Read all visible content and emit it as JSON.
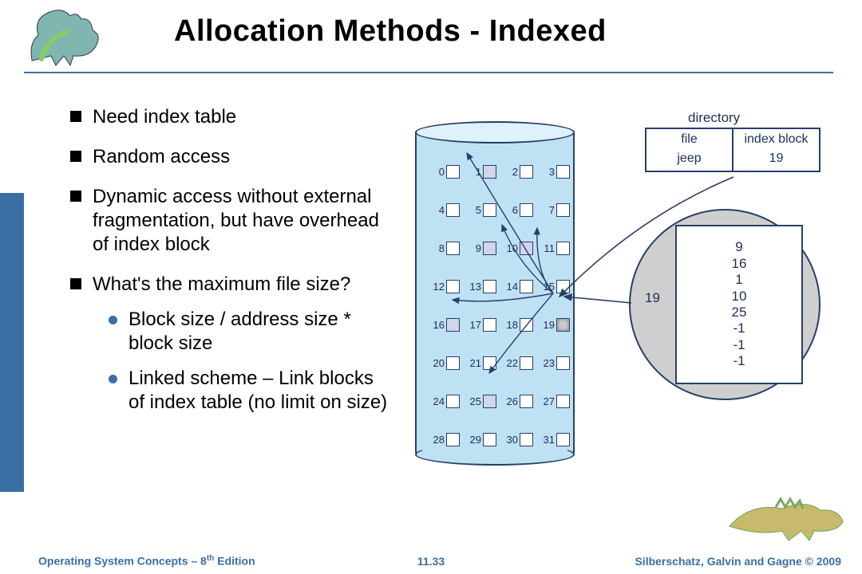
{
  "title": "Allocation Methods - Indexed",
  "bullets": {
    "items": [
      {
        "text": "Need index table"
      },
      {
        "text": "Random access"
      },
      {
        "text": "Dynamic access without external fragmentation, but have overhead of index block"
      },
      {
        "text": "What's the maximum file size?"
      }
    ],
    "sub": [
      {
        "text": "Block size / address size * block size"
      },
      {
        "text": "Linked scheme – Link blocks of index table (no limit on size)"
      }
    ]
  },
  "figure": {
    "directory_label": "directory",
    "dir_headers": {
      "col1": "file",
      "col2": "index block"
    },
    "dir_values": {
      "col1": "jeep",
      "col2": "19"
    },
    "cells": [
      "0",
      "1",
      "2",
      "3",
      "4",
      "5",
      "6",
      "7",
      "8",
      "9",
      "10",
      "11",
      "12",
      "13",
      "14",
      "15",
      "16",
      "17",
      "18",
      "19",
      "20",
      "21",
      "22",
      "23",
      "24",
      "25",
      "26",
      "27",
      "28",
      "29",
      "30",
      "31"
    ],
    "selected": [
      1,
      9,
      10,
      16,
      25
    ],
    "index_cell": 19,
    "index_num": "19",
    "index_table": [
      "9",
      "16",
      "1",
      "10",
      "25",
      "-1",
      "-1",
      "-1"
    ]
  },
  "footer": {
    "left_a": "Operating System Concepts – 8",
    "left_sup": "th",
    "left_b": " Edition",
    "mid": "11.33",
    "right": "Silberschatz, Galvin and Gagne © 2009"
  }
}
